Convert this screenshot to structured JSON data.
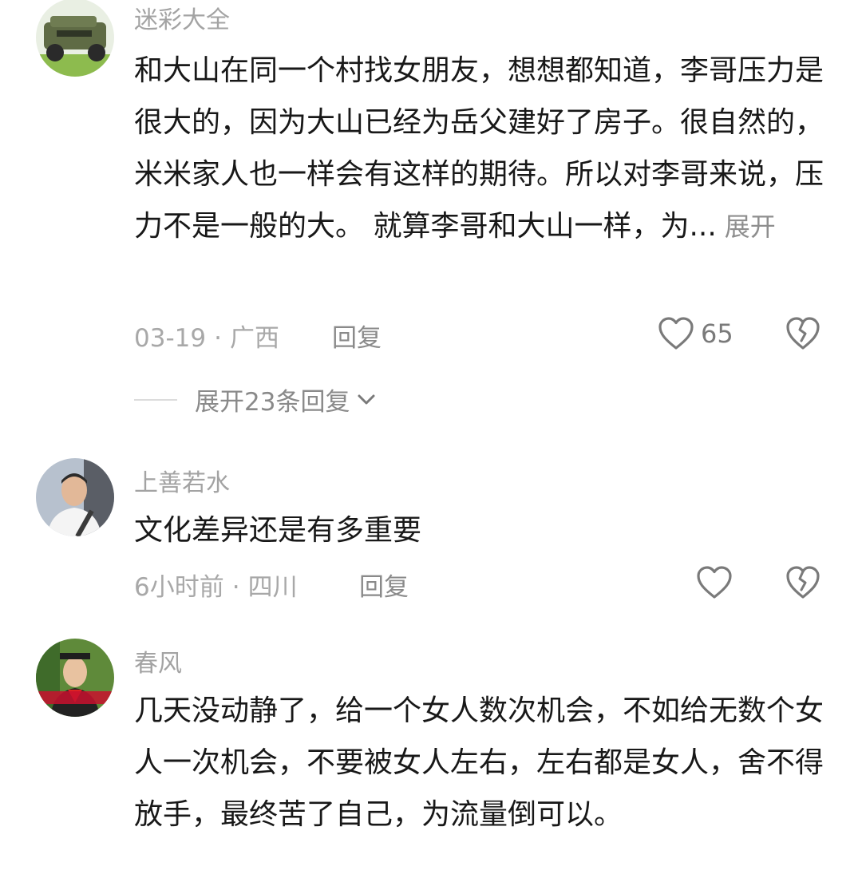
{
  "comments": [
    {
      "username": "迷彩大全",
      "text": "和大山在同一个村找女朋友，想想都知道，李哥压力是很大的，因为大山已经为岳父建好了房子。很自然的，米米家人也一样会有这样的期待。所以对李哥来说，压力不是一般的大。 就算李哥和大山一样，为...",
      "expand_label": "展开",
      "date": "03-19",
      "separator": "·",
      "location": "广西",
      "reply_label": "回复",
      "likes": "65",
      "expand_replies_label": "展开23条回复"
    },
    {
      "username": "上善若水",
      "text": "文化差异还是有多重要",
      "date": "6小时前",
      "separator": "·",
      "location": "四川",
      "reply_label": "回复"
    },
    {
      "username": "春风",
      "text": "几天没动静了，给一个女人数次机会，不如给无数个女人一次机会，不要被女人左右，左右都是女人，舍不得放手，最终苦了自己，为流量倒可以。"
    }
  ],
  "icons": {
    "like": "heart-outline-icon",
    "dislike": "broken-heart-icon",
    "expand": "chevron-down-icon"
  },
  "colors": {
    "text": "#181818",
    "muted": "#a8a8a8",
    "icon": "#7a7a7a"
  }
}
